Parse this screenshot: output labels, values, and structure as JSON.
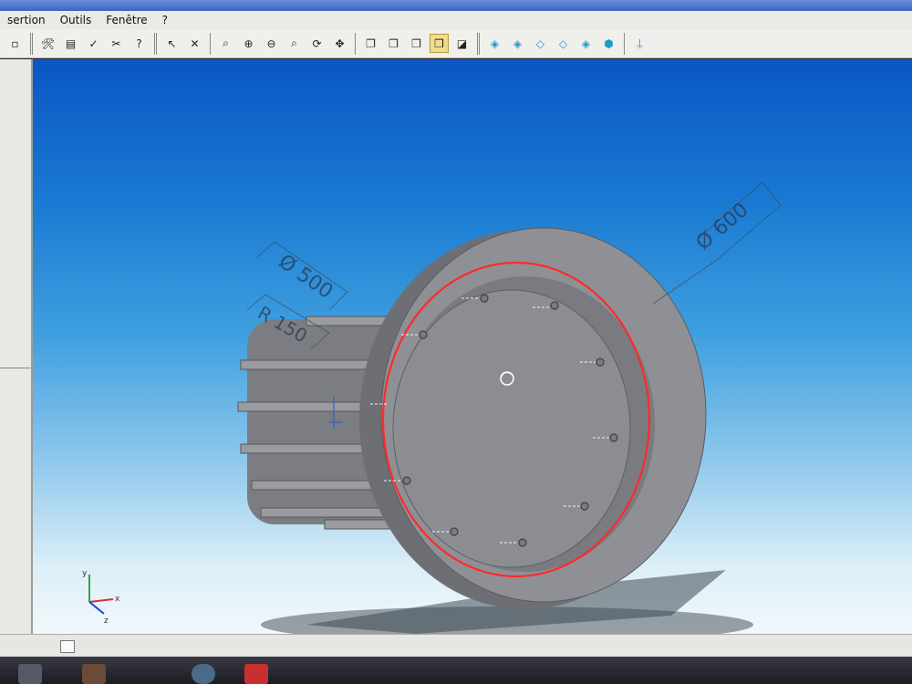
{
  "menu": {
    "items": [
      "sertion",
      "Outils",
      "Fenêtre",
      "?"
    ]
  },
  "toolbar": {
    "groups": [
      [
        "wrench-icon",
        "book-icon",
        "check-icon",
        "tools-icon",
        "help-icon"
      ],
      [
        "pointer-icon",
        "measure-icon"
      ],
      [
        "zoom-icon",
        "zoom-in-icon",
        "zoom-out-icon",
        "zoom-window-icon",
        "rotate-icon",
        "pan-icon"
      ],
      [
        "view-front-icon",
        "view-back-icon",
        "view-left-icon",
        "view-iso-icon",
        "view-top-icon"
      ],
      [
        "shaded-icon",
        "shaded-edges-icon",
        "wireframe-icon",
        "hidden-lines-icon",
        "section-icon",
        "cube-icon"
      ],
      [
        "render-icon"
      ]
    ],
    "active_tool": "view-iso-icon"
  },
  "model": {
    "annotations": {
      "outer_diameter": "Ø 600",
      "inner_diameter": "Ø 500",
      "radius": "R 150"
    },
    "colors": {
      "part": "#8b8c91",
      "highlight_circle": "#ff2a2a",
      "background_top": "#0a56c4",
      "background_bottom": "#f2f8fb"
    }
  },
  "axis_triad": {
    "labels": [
      "x",
      "y",
      "z"
    ]
  }
}
